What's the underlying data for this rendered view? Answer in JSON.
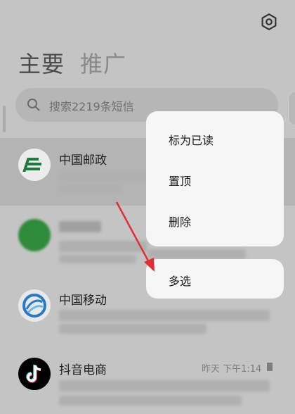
{
  "header": {
    "tab_main": "主要",
    "tab_promo": "推广"
  },
  "search": {
    "placeholder": "搜索2219条短信"
  },
  "conversations": [
    {
      "name": "中国邮政",
      "avatar_color": "#1c7a3e"
    },
    {
      "name": "",
      "avatar_color": "#2e8b3a"
    },
    {
      "name": "中国移动",
      "avatar_color": "#2a79c9"
    },
    {
      "name": "抖音电商",
      "time": "昨天 下午1:14",
      "avatar_color": "#000000"
    }
  ],
  "context_menu": {
    "items": [
      "标为已读",
      "置顶",
      "删除"
    ]
  },
  "multi_select": {
    "label": "多选"
  },
  "colors": {
    "accent_arrow": "#e03030",
    "menu_bg": "#f6f6f6"
  },
  "icons": {
    "settings": "gear-icon",
    "search": "search-icon"
  }
}
